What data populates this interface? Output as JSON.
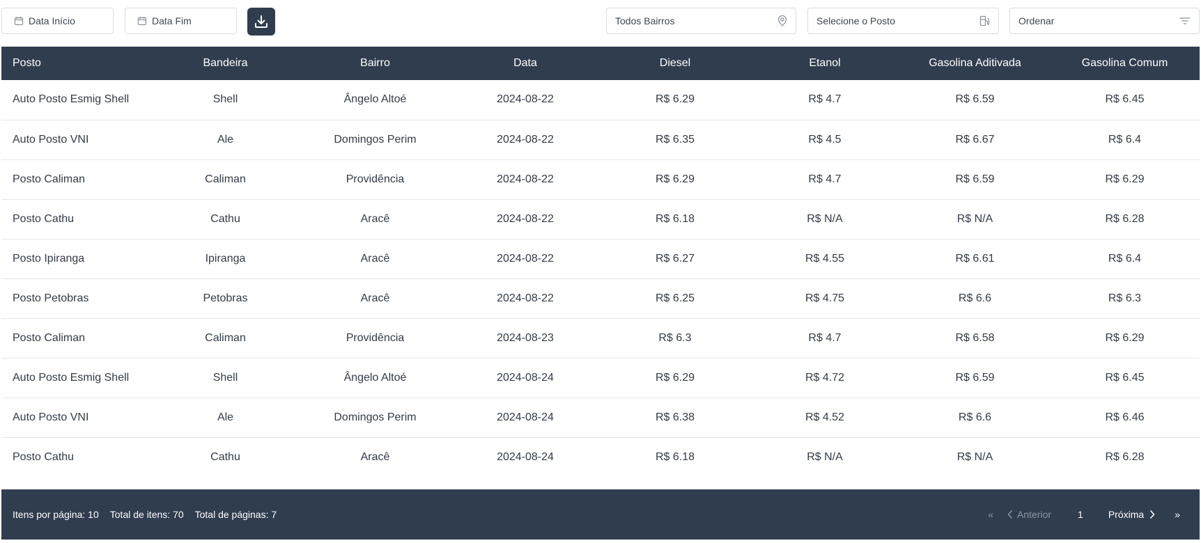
{
  "filters": {
    "date_start": {
      "label": "Data Início",
      "icon": "calendar-icon"
    },
    "date_end": {
      "label": "Data Fim",
      "icon": "calendar-icon"
    },
    "download": {
      "icon": "download-icon"
    },
    "bairro": {
      "value": "Todos Bairros",
      "icon": "map-pin-icon"
    },
    "posto": {
      "value": "Selecione o Posto",
      "icon": "fuel-pump-icon"
    },
    "order": {
      "value": "Ordenar",
      "icon": "filter-icon"
    }
  },
  "table": {
    "headers": {
      "posto": "Posto",
      "bandeira": "Bandeira",
      "bairro": "Bairro",
      "data": "Data",
      "diesel": "Diesel",
      "etanol": "Etanol",
      "gas_aditivada": "Gasolina Aditivada",
      "gas_comum": "Gasolina Comum"
    },
    "rows": [
      [
        "Auto Posto Esmig Shell",
        "Shell",
        "Ângelo Altoé",
        "2024-08-22",
        "R$ 6.29",
        "R$ 4.7",
        "R$ 6.59",
        "R$ 6.45"
      ],
      [
        "Auto Posto VNI",
        "Ale",
        "Domingos Perim",
        "2024-08-22",
        "R$ 6.35",
        "R$ 4.5",
        "R$ 6.67",
        "R$ 6.4"
      ],
      [
        "Posto Caliman",
        "Caliman",
        "Providência",
        "2024-08-22",
        "R$ 6.29",
        "R$ 4.7",
        "R$ 6.59",
        "R$ 6.29"
      ],
      [
        "Posto Cathu",
        "Cathu",
        "Aracê",
        "2024-08-22",
        "R$ 6.18",
        "R$ N/A",
        "R$ N/A",
        "R$ 6.28"
      ],
      [
        "Posto Ipiranga",
        "Ipiranga",
        "Aracê",
        "2024-08-22",
        "R$ 6.27",
        "R$ 4.55",
        "R$ 6.61",
        "R$ 6.4"
      ],
      [
        "Posto Petobras",
        "Petobras",
        "Aracê",
        "2024-08-22",
        "R$ 6.25",
        "R$ 4.75",
        "R$ 6.6",
        "R$ 6.3"
      ],
      [
        "Posto Caliman",
        "Caliman",
        "Providência",
        "2024-08-23",
        "R$ 6.3",
        "R$ 4.7",
        "R$ 6.58",
        "R$ 6.29"
      ],
      [
        "Auto Posto Esmig Shell",
        "Shell",
        "Ângelo Altoé",
        "2024-08-24",
        "R$ 6.29",
        "R$ 4.72",
        "R$ 6.59",
        "R$ 6.45"
      ],
      [
        "Auto Posto VNI",
        "Ale",
        "Domingos Perim",
        "2024-08-24",
        "R$ 6.38",
        "R$ 4.52",
        "R$ 6.6",
        "R$ 6.46"
      ],
      [
        "Posto Cathu",
        "Cathu",
        "Aracê",
        "2024-08-24",
        "R$ 6.18",
        "R$ N/A",
        "R$ N/A",
        "R$ 6.28"
      ]
    ]
  },
  "footer": {
    "items_per_page": "Itens por página: 10",
    "total_items": "Total de itens: 70",
    "total_pages": "Total de páginas: 7",
    "pager": {
      "first_label": "«",
      "prev_label": "Anterior",
      "current_page": "1",
      "next_label": "Próxima",
      "last_label": "»"
    }
  },
  "colors": {
    "header_bg": "#303d4f",
    "text": "#333b47",
    "border": "#d9dce1",
    "muted": "#8b95a3"
  }
}
